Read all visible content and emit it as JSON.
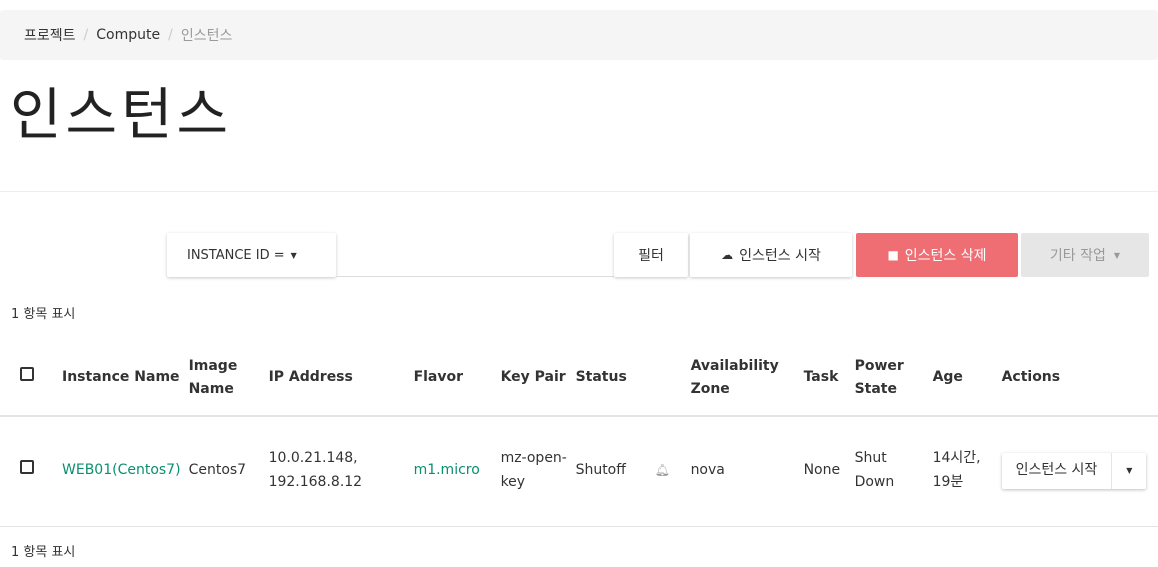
{
  "breadcrumb": {
    "item1": "프로젝트",
    "item2": "Compute",
    "item3": "인스턴스",
    "sep": "/"
  },
  "page": {
    "title": "인스턴스"
  },
  "toolbar": {
    "filter_field": "INSTANCE ID =",
    "filter_value": "",
    "filter_button": "필터",
    "launch_button": "인스턴스 시작",
    "delete_button": "인스턴스 삭제",
    "more_button": "기타 작업"
  },
  "summary": {
    "count_text": "1 항목 표시"
  },
  "table": {
    "headers": {
      "name": "Instance Name",
      "image": "Image Name",
      "ip": "IP Address",
      "flavor": "Flavor",
      "keypair": "Key Pair",
      "status": "Status",
      "az": "Availability Zone",
      "task": "Task",
      "power": "Power State",
      "age": "Age",
      "actions": "Actions"
    },
    "rows": [
      {
        "name": "WEB01(Centos7)",
        "image": "Centos7",
        "ip": "10.0.21.148, 192.168.8.12",
        "flavor": "m1.micro",
        "keypair": "mz-open-key",
        "status": "Shutoff",
        "az": "nova",
        "task": "None",
        "power": "Shut Down",
        "age": "14시간, 19분",
        "action_label": "인스턴스 시작"
      }
    ]
  },
  "colors": {
    "link": "#0d8f6f",
    "danger": "#ee6e73",
    "muted": "#e6e6e6"
  },
  "icons": {
    "launch": "cloud-upload-icon",
    "delete": "trash-icon",
    "status": "bell-icon",
    "dropdown": "caret-down-icon"
  }
}
